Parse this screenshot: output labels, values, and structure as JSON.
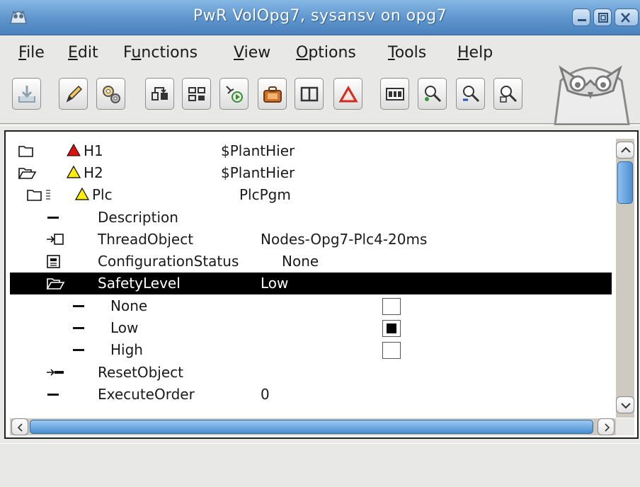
{
  "window": {
    "title": "PwR VolOpg7,   sysansv on opg7"
  },
  "menu": [
    {
      "label": "File",
      "mnemonic": "F",
      "rest": "ile"
    },
    {
      "label": "Edit",
      "mnemonic": "E",
      "rest": "dit"
    },
    {
      "label": "Functions",
      "pre": "F",
      "mnemonic": "u",
      "rest": "nctions"
    },
    {
      "label": "View",
      "mnemonic": "V",
      "rest": "iew"
    },
    {
      "label": "Options",
      "mnemonic": "O",
      "rest": "ptions"
    },
    {
      "label": "Tools",
      "mnemonic": "T",
      "rest": "ools"
    },
    {
      "label": "Help",
      "mnemonic": "H",
      "rest": "elp"
    }
  ],
  "toolbar": [
    {
      "icon": "import-icon"
    },
    {
      "icon": "edit-pencil-icon"
    },
    {
      "icon": "gears-icon"
    },
    {
      "icon": "distribute-icon"
    },
    {
      "icon": "hierarchy-icon"
    },
    {
      "icon": "trace-icon"
    },
    {
      "icon": "suitcase-icon"
    },
    {
      "icon": "columns-icon"
    },
    {
      "icon": "alarm-triangle-icon"
    },
    {
      "icon": "io-icon"
    },
    {
      "icon": "zoom-in-icon"
    },
    {
      "icon": "zoom-out-icon"
    },
    {
      "icon": "zoom-reset-icon"
    }
  ],
  "tree": [
    {
      "name": "H1",
      "class": "$PlantHier",
      "icon": "folder-closed-icon",
      "marker": "red"
    },
    {
      "name": "H2",
      "class": "$PlantHier",
      "icon": "folder-open-icon",
      "marker": "yellow"
    },
    {
      "name": "Plc",
      "class": "PlcPgm",
      "icon": "folder-closed-icon",
      "marker": "yellow"
    },
    {
      "name": "Description",
      "class": "",
      "icon": "attribute-icon"
    },
    {
      "name": "ThreadObject",
      "class": "Nodes-Opg7-Plc4-20ms",
      "icon": "object-ref-icon"
    },
    {
      "name": "ConfigurationStatus",
      "class": "None",
      "icon": "status-icon"
    },
    {
      "name": "SafetyLevel",
      "class": "Low",
      "icon": "folder-open-icon",
      "selected": true
    },
    {
      "name": "None",
      "class": "",
      "icon": "attribute-icon",
      "checked": false
    },
    {
      "name": "Low",
      "class": "",
      "icon": "attribute-icon",
      "checked": true
    },
    {
      "name": "High",
      "class": "",
      "icon": "attribute-icon",
      "checked": false
    },
    {
      "name": "ResetObject",
      "class": "",
      "icon": "reset-ref-icon"
    },
    {
      "name": "ExecuteOrder",
      "class": "0",
      "icon": "attribute-icon"
    }
  ]
}
